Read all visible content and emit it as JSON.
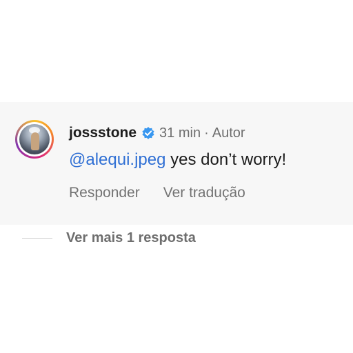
{
  "comment": {
    "username": "jossstone",
    "verified_icon": "verified-badge-icon",
    "time": "31 min",
    "separator": "·",
    "author_label": "Autor",
    "mention": "@alequi.jpeg",
    "text": " yes don’t worry!",
    "actions": {
      "reply": "Responder",
      "translate": "Ver tradução"
    }
  },
  "replies": {
    "more_label": "Ver mais 1 resposta"
  },
  "colors": {
    "mention": "#2f6fd4",
    "verified": "#3897f0",
    "comment_bg": "#f7f7f7"
  }
}
